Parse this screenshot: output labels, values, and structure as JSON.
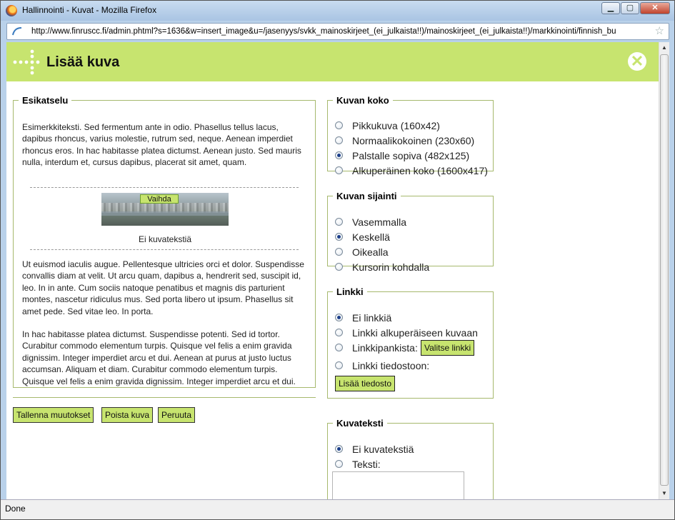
{
  "window": {
    "title": "Hallinnointi - Kuvat - Mozilla Firefox",
    "url": "http://www.finruscc.fi/admin.phtml?s=1636&w=insert_image&u=/jasenyys/svkk_mainoskirjeet_(ei_julkaista!!)/mainoskirjeet_(ei_julkaista!!)/markkinointi/finnish_bu",
    "status": "Done"
  },
  "header": {
    "title": "Lisää kuva"
  },
  "preview": {
    "legend": "Esikatselu",
    "text_top": "Esimerkkiteksti. Sed fermentum ante in odio. Phasellus tellus lacus, dapibus rhoncus, varius molestie, rutrum sed, neque. Aenean imperdiet rhoncus eros. In hac habitasse platea dictumst. Aenean justo. Sed mauris nulla, interdum et, cursus dapibus, placerat sit amet, quam.",
    "change_label": "Vaihda",
    "caption": "Ei kuvatekstiä",
    "text_mid": "Ut euismod iaculis augue. Pellentesque ultricies orci et dolor. Suspendisse convallis diam at velit. Ut arcu quam, dapibus a, hendrerit sed, suscipit id, leo. In in ante. Cum sociis natoque penatibus et magnis dis parturient montes, nascetur ridiculus mus. Sed porta libero ut ipsum. Phasellus sit amet pede. Sed vitae leo. In porta.",
    "text_bottom": "In hac habitasse platea dictumst. Suspendisse potenti. Sed id tortor. Curabitur commodo elementum turpis. Quisque vel felis a enim gravida dignissim. Integer imperdiet arcu et dui. Aenean at purus at justo luctus accumsan. Aliquam et diam. Curabitur commodo elementum turpis. Quisque vel felis a enim gravida dignissim. Integer imperdiet arcu et dui."
  },
  "actions": {
    "save": "Tallenna muutokset",
    "delete": "Poista kuva",
    "cancel": "Peruuta"
  },
  "size": {
    "legend": "Kuvan koko",
    "options": [
      "Pikkukuva (160x42)",
      "Normaalikokoinen (230x60)",
      "Palstalle sopiva (482x125)",
      "Alkuperäinen koko (1600x417)"
    ],
    "selected": 2
  },
  "position": {
    "legend": "Kuvan sijainti",
    "options": [
      "Vasemmalla",
      "Keskellä",
      "Oikealla",
      "Kursorin kohdalla"
    ],
    "selected": 1
  },
  "link": {
    "legend": "Linkki",
    "options": [
      "Ei linkkiä",
      "Linkki alkuperäiseen kuvaan",
      "Linkkipankista:",
      "Linkki tiedostoon:"
    ],
    "selected": 0,
    "choose_link_button": "Valitse linkki",
    "add_file_button": "Lisää tiedosto"
  },
  "caption_box": {
    "legend": "Kuvateksti",
    "options": [
      "Ei kuvatekstiä",
      "Teksti:"
    ],
    "selected": 0,
    "text_value": ""
  },
  "colors": {
    "accent": "#c7e46f",
    "border": "#a6b96d"
  }
}
